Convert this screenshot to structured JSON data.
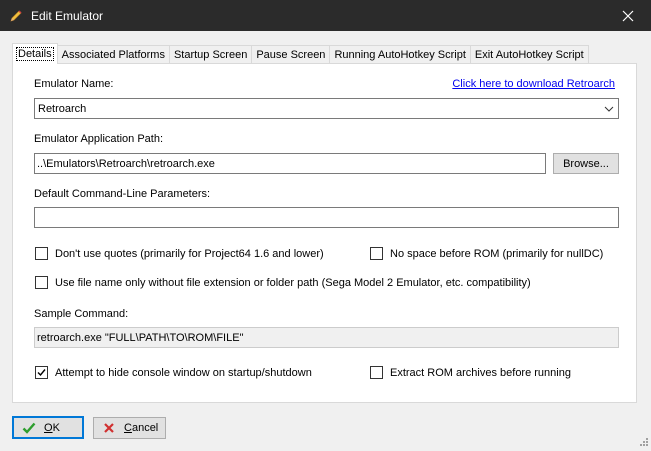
{
  "window": {
    "title": "Edit Emulator",
    "icon": "pencil-icon",
    "close_icon": "close-icon"
  },
  "tabs": [
    {
      "label": "Details",
      "active": true
    },
    {
      "label": "Associated Platforms",
      "active": false
    },
    {
      "label": "Startup Screen",
      "active": false
    },
    {
      "label": "Pause Screen",
      "active": false
    },
    {
      "label": "Running AutoHotkey Script",
      "active": false
    },
    {
      "label": "Exit AutoHotkey Script",
      "active": false
    }
  ],
  "details": {
    "emulator_name_label": "Emulator Name:",
    "download_link": "Click here to download Retroarch",
    "emulator_name_value": "Retroarch",
    "app_path_label": "Emulator Application Path:",
    "app_path_value": "..\\Emulators\\Retroarch\\retroarch.exe",
    "browse_label": "Browse...",
    "cmdline_label": "Default Command-Line Parameters:",
    "cmdline_value": "",
    "no_quotes_label": "Don't use quotes (primarily for Project64 1.6 and lower)",
    "no_quotes_checked": false,
    "no_space_label": "No space before ROM (primarily for nullDC)",
    "no_space_checked": false,
    "filename_only_label": "Use file name only without file extension or folder path (Sega Model 2 Emulator, etc. compatibility)",
    "filename_only_checked": false,
    "sample_command_label": "Sample Command:",
    "sample_command_value": "retroarch.exe \"FULL\\PATH\\TO\\ROM\\FILE\"",
    "hide_console_label": "Attempt to hide console window on startup/shutdown",
    "hide_console_checked": true,
    "extract_rom_label": "Extract ROM archives before running",
    "extract_rom_checked": false
  },
  "buttons": {
    "ok_underline": "O",
    "ok_rest": "K",
    "cancel_underline": "C",
    "cancel_rest": "ancel"
  },
  "colors": {
    "titlebar": "#2b2b2b",
    "accent": "#0078d7",
    "link": "#0000ee",
    "ok_green": "#2e9e2e",
    "cancel_red": "#d03030"
  }
}
